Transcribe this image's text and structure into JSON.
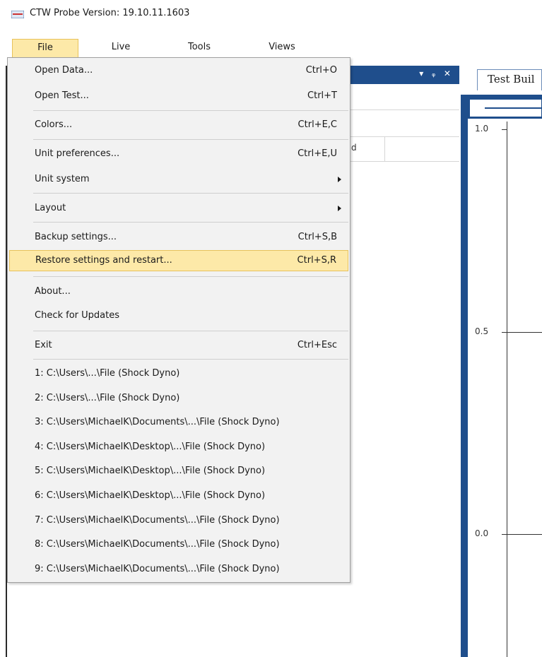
{
  "window": {
    "title": "CTW Probe Version: 19.10.11.1603"
  },
  "menubar": [
    {
      "label": "File",
      "active": true
    },
    {
      "label": "Live"
    },
    {
      "label": "Tools"
    },
    {
      "label": "Views"
    }
  ],
  "panel": {
    "controls": "▾ ᵩ ✕",
    "grid_fragment": "d"
  },
  "right_tab": {
    "label": "Test Buil"
  },
  "chart_data": {
    "type": "line",
    "title": "",
    "xlabel": "",
    "ylabel": "",
    "ylim": [
      0.0,
      1.0
    ],
    "y_ticks": [
      "1.0",
      "0.5",
      "0.0"
    ],
    "series": []
  },
  "file_menu": {
    "items": [
      {
        "label": "Open Data...",
        "shortcut": "Ctrl+O"
      },
      {
        "label": "Open Test...",
        "shortcut": "Ctrl+T"
      },
      {
        "label": "Colors...",
        "shortcut": "Ctrl+E,C"
      },
      {
        "label": "Unit preferences...",
        "shortcut": "Ctrl+E,U"
      },
      {
        "label": "Unit system",
        "submenu": true
      },
      {
        "label": "Layout",
        "submenu": true
      },
      {
        "label": "Backup settings...",
        "shortcut": "Ctrl+S,B"
      },
      {
        "label": "Restore settings and restart...",
        "shortcut": "Ctrl+S,R",
        "highlighted": true
      },
      {
        "label": "About..."
      },
      {
        "label": "Check for Updates"
      },
      {
        "label": "Exit",
        "shortcut": "Ctrl+Esc"
      }
    ],
    "recent_files": [
      "1: C:\\Users\\...\\File (Shock Dyno)",
      "2: C:\\Users\\...\\File (Shock Dyno)",
      "3: C:\\Users\\MichaelK\\Documents\\...\\File (Shock Dyno)",
      "4: C:\\Users\\MichaelK\\Desktop\\...\\File (Shock Dyno)",
      "5: C:\\Users\\MichaelK\\Desktop\\...\\File (Shock Dyno)",
      "6: C:\\Users\\MichaelK\\Desktop\\...\\File (Shock Dyno)",
      "7: C:\\Users\\MichaelK\\Documents\\...\\File (Shock Dyno)",
      "8: C:\\Users\\MichaelK\\Documents\\...\\File (Shock Dyno)",
      "9: C:\\Users\\MichaelK\\Documents\\...\\File (Shock Dyno)"
    ]
  }
}
